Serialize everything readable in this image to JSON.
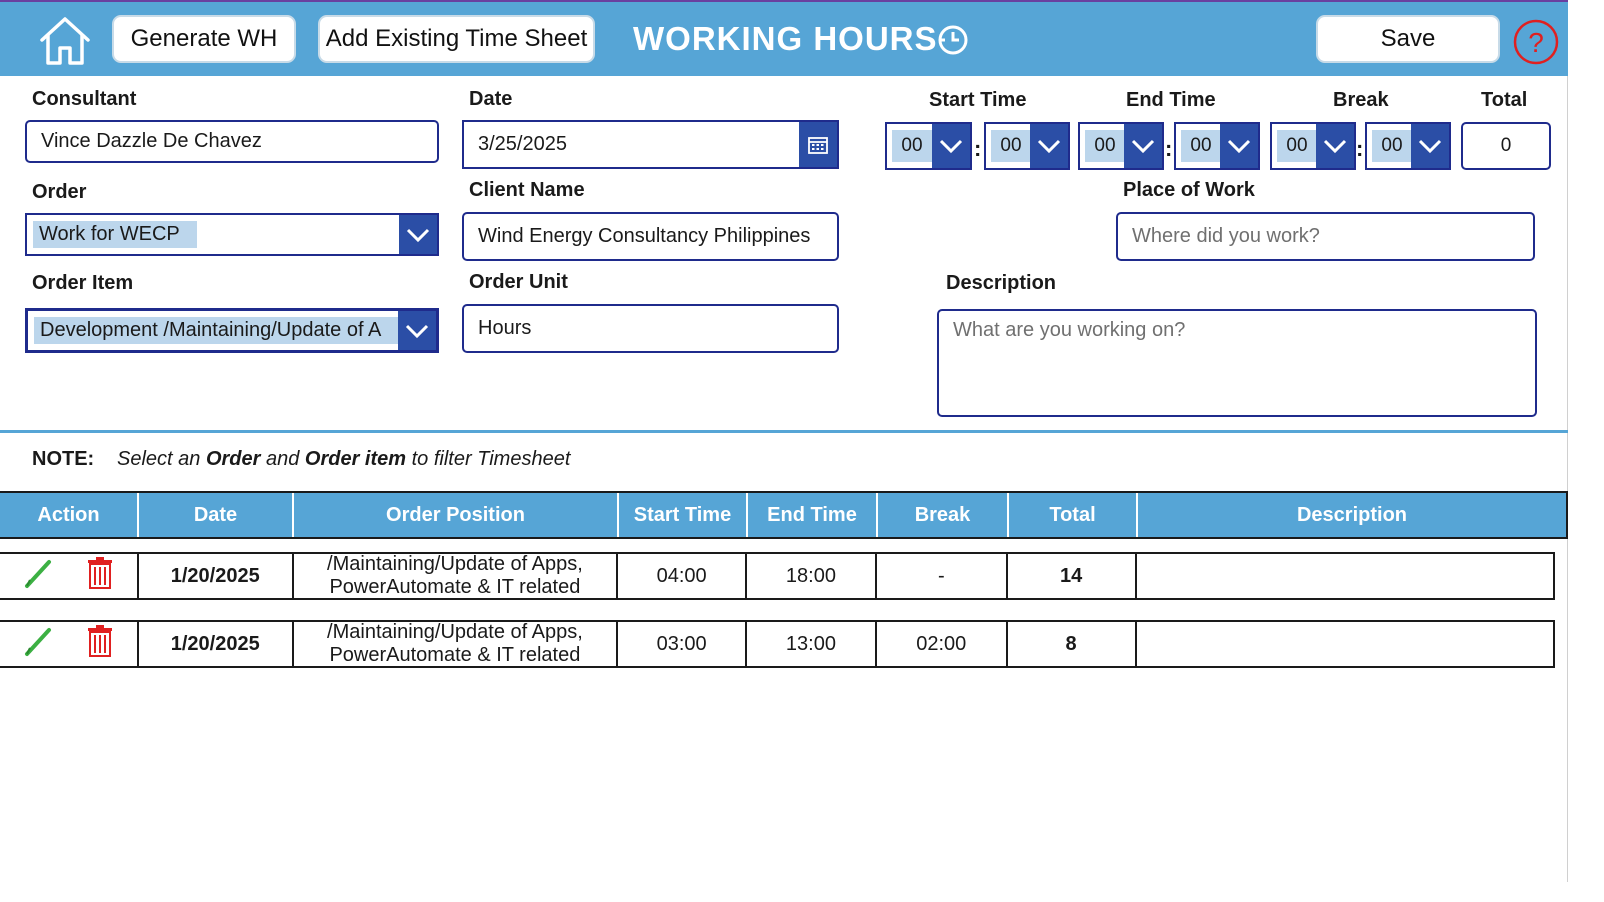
{
  "header": {
    "generate_label": "Generate WH",
    "add_existing_label": "Add Existing Time Sheet",
    "title": "WORKING HOURS",
    "save_label": "Save"
  },
  "form": {
    "consultant": {
      "label": "Consultant",
      "value": "Vince Dazzle De Chavez"
    },
    "date": {
      "label": "Date",
      "value": "3/25/2025"
    },
    "order": {
      "label": "Order",
      "value": "Work for WECP"
    },
    "client_name": {
      "label": "Client Name",
      "value": "Wind Energy Consultancy Philippines"
    },
    "order_item": {
      "label": "Order Item",
      "value": "Development /Maintaining/Update of A"
    },
    "order_unit": {
      "label": "Order Unit",
      "value": "Hours"
    },
    "start_time": {
      "label": "Start Time",
      "hour": "00",
      "minute": "00"
    },
    "end_time": {
      "label": "End Time",
      "hour": "00",
      "minute": "00"
    },
    "break": {
      "label": "Break",
      "hour": "00",
      "minute": "00"
    },
    "total": {
      "label": "Total",
      "value": "0"
    },
    "place_of_work": {
      "label": "Place of Work",
      "placeholder": "Where did you work?"
    },
    "description": {
      "label": "Description",
      "placeholder": "What are you working on?"
    },
    "colon": ":"
  },
  "note": {
    "label": "NOTE:",
    "t1": "Select an ",
    "b1": "Order",
    "t2": " and ",
    "b2": "Order item",
    "t3": " to filter Timesheet"
  },
  "table": {
    "columns": [
      "Action",
      "Date",
      "Order Position",
      "Start Time",
      "End Time",
      "Break",
      "Total",
      "Description"
    ],
    "rows": [
      {
        "date": "1/20/2025",
        "position_line1": "/Maintaining/Update of Apps,",
        "position_line2": "PowerAutomate & IT related",
        "start": "04:00",
        "end": "18:00",
        "break": "-",
        "total": "14",
        "description": ""
      },
      {
        "date": "1/20/2025",
        "position_line1": "/Maintaining/Update of Apps,",
        "position_line2": "PowerAutomate & IT related",
        "start": "03:00",
        "end": "13:00",
        "break": "02:00",
        "total": "8",
        "description": ""
      }
    ]
  },
  "icons": {
    "home": "home-icon",
    "clock": "clock-icon",
    "help": "help-icon",
    "calendar": "calendar-icon",
    "chevron": "chevron-down-icon",
    "edit": "pencil-icon",
    "delete": "trash-icon"
  },
  "colors": {
    "header_bg": "#56a5d6",
    "accent_dark": "#2b4ea6",
    "border": "#1f2b8c",
    "select_bg": "#bcd6ec",
    "delete": "#e02020",
    "edit": "#3cb043",
    "help": "#e02020"
  }
}
